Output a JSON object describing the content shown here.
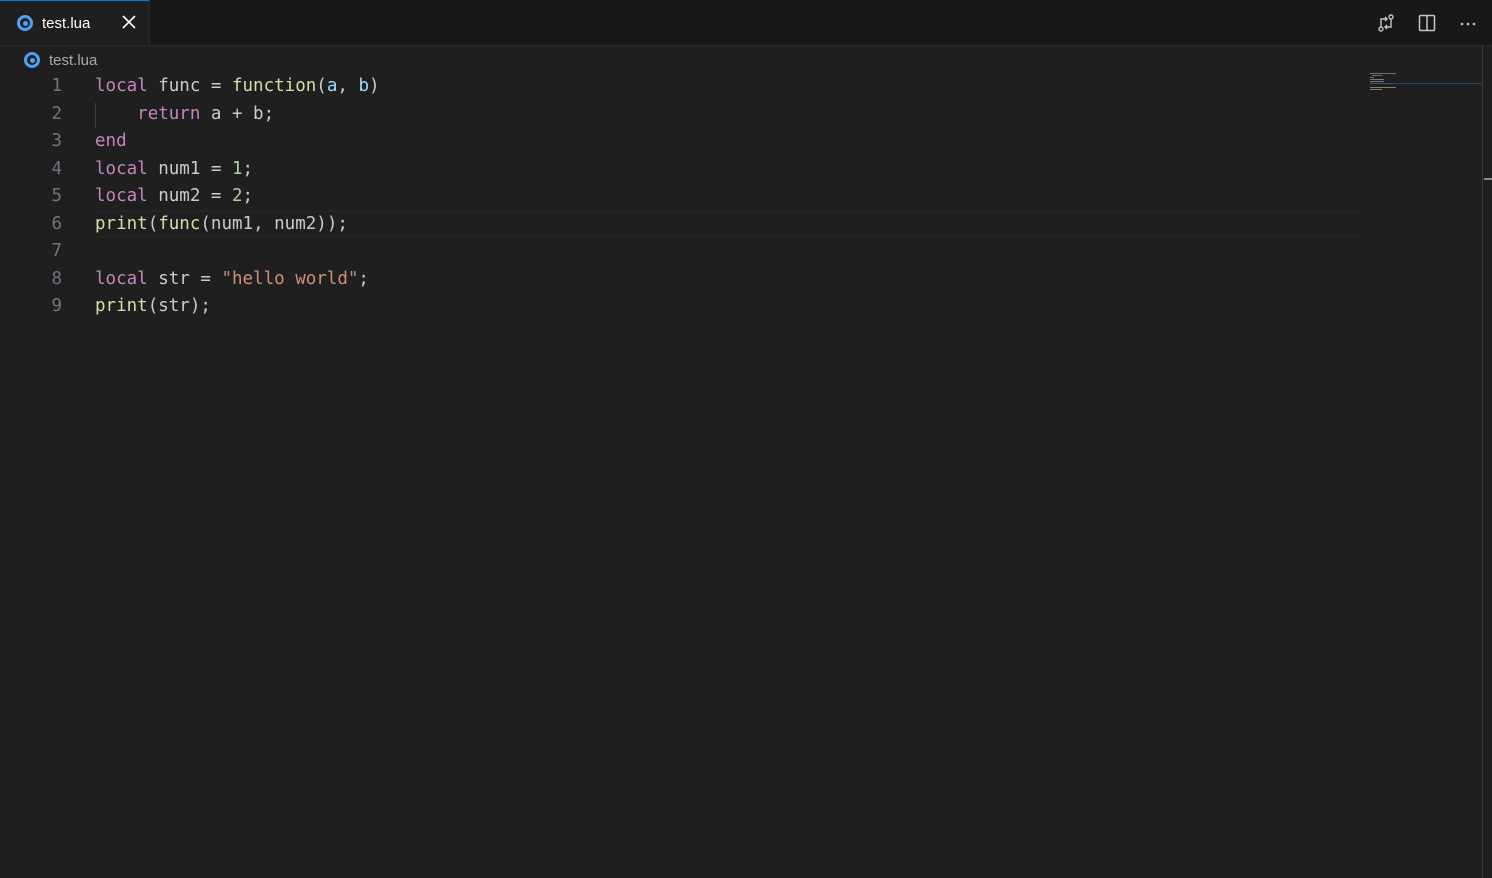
{
  "tab": {
    "label": "test.lua",
    "file_icon": "lua-file-icon",
    "close_icon": "close-icon"
  },
  "toolbar": {
    "icons": [
      "compare-changes-icon",
      "split-editor-icon",
      "more-actions-icon"
    ]
  },
  "breadcrumb": {
    "label": "test.lua"
  },
  "editor": {
    "language": "lua",
    "lines": [
      {
        "number": "1",
        "tokens": [
          [
            "k",
            "local"
          ],
          [
            "t",
            " func = "
          ],
          [
            "f",
            "function"
          ],
          [
            "t",
            "("
          ],
          [
            "p",
            "a"
          ],
          [
            "t",
            ", "
          ],
          [
            "p",
            "b"
          ],
          [
            "t",
            ")"
          ]
        ]
      },
      {
        "number": "2",
        "tokens": [
          [
            "t",
            "    "
          ],
          [
            "k",
            "return"
          ],
          [
            "t",
            " a + b;"
          ]
        ]
      },
      {
        "number": "3",
        "tokens": [
          [
            "k",
            "end"
          ]
        ]
      },
      {
        "number": "4",
        "tokens": [
          [
            "k",
            "local"
          ],
          [
            "t",
            " num1 = "
          ],
          [
            "n",
            "1"
          ],
          [
            "t",
            ";"
          ]
        ]
      },
      {
        "number": "5",
        "tokens": [
          [
            "k",
            "local"
          ],
          [
            "t",
            " num2 = "
          ],
          [
            "n",
            "2"
          ],
          [
            "t",
            ";"
          ]
        ]
      },
      {
        "number": "6",
        "tokens": [
          [
            "f",
            "print"
          ],
          [
            "t",
            "("
          ],
          [
            "f",
            "func"
          ],
          [
            "t",
            "(num1, num2));"
          ]
        ]
      },
      {
        "number": "7",
        "tokens": []
      },
      {
        "number": "8",
        "tokens": [
          [
            "k",
            "local"
          ],
          [
            "t",
            " str = "
          ],
          [
            "s",
            "\"hello world\""
          ],
          [
            "t",
            ";"
          ]
        ]
      },
      {
        "number": "9",
        "tokens": [
          [
            "f",
            "print"
          ],
          [
            "t",
            "(str);"
          ]
        ]
      }
    ],
    "current_line": 6
  },
  "colors": {
    "accent": "#0078d4",
    "keyword": "#c586c0",
    "function": "#dcdcaa",
    "parameter": "#9cdcfe",
    "number": "#b5cea8",
    "string": "#ce9178",
    "lua_icon": "#51a0f3"
  }
}
